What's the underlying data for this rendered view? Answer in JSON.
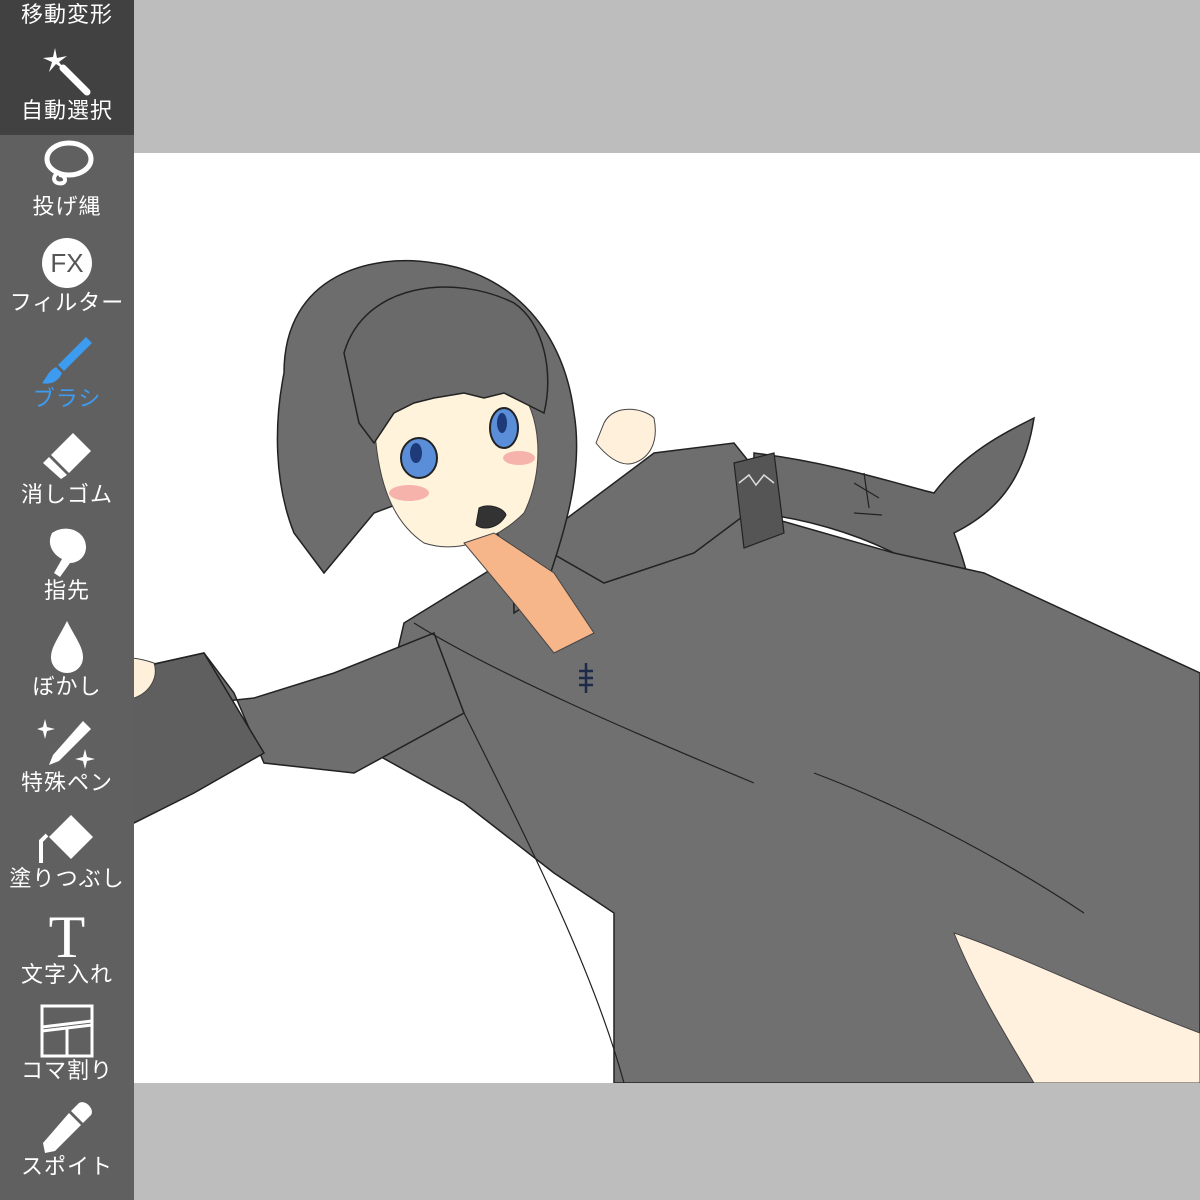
{
  "app": {
    "accent_color": "#3d9bf0",
    "toolbar_bg": "#4a4a4a",
    "canvas_bg": "#ffffff",
    "workspace_bg": "#bdbdbd"
  },
  "toolbar": {
    "items": [
      {
        "label": "移動変形",
        "icon": "move-transform-icon",
        "active": false
      },
      {
        "label": "自動選択",
        "icon": "magic-wand-icon",
        "active": false
      },
      {
        "label": "投げ縄",
        "icon": "lasso-icon",
        "active": false
      },
      {
        "label": "フィルター",
        "icon": "fx-filter-icon",
        "active": false
      },
      {
        "label": "ブラシ",
        "icon": "brush-icon",
        "active": true
      },
      {
        "label": "消しゴム",
        "icon": "eraser-icon",
        "active": false
      },
      {
        "label": "指先",
        "icon": "finger-smudge-icon",
        "active": false
      },
      {
        "label": "ぼかし",
        "icon": "blur-drop-icon",
        "active": false
      },
      {
        "label": "特殊ペン",
        "icon": "special-pen-icon",
        "active": false
      },
      {
        "label": "塗りつぶし",
        "icon": "fill-bucket-icon",
        "active": false
      },
      {
        "label": "文字入れ",
        "icon": "text-icon",
        "active": false
      },
      {
        "label": "コマ割り",
        "icon": "panel-divide-icon",
        "active": false
      },
      {
        "label": "スポイト",
        "icon": "eyedropper-icon",
        "active": false
      }
    ],
    "fx_glyph": "FX",
    "text_glyph": "T"
  }
}
